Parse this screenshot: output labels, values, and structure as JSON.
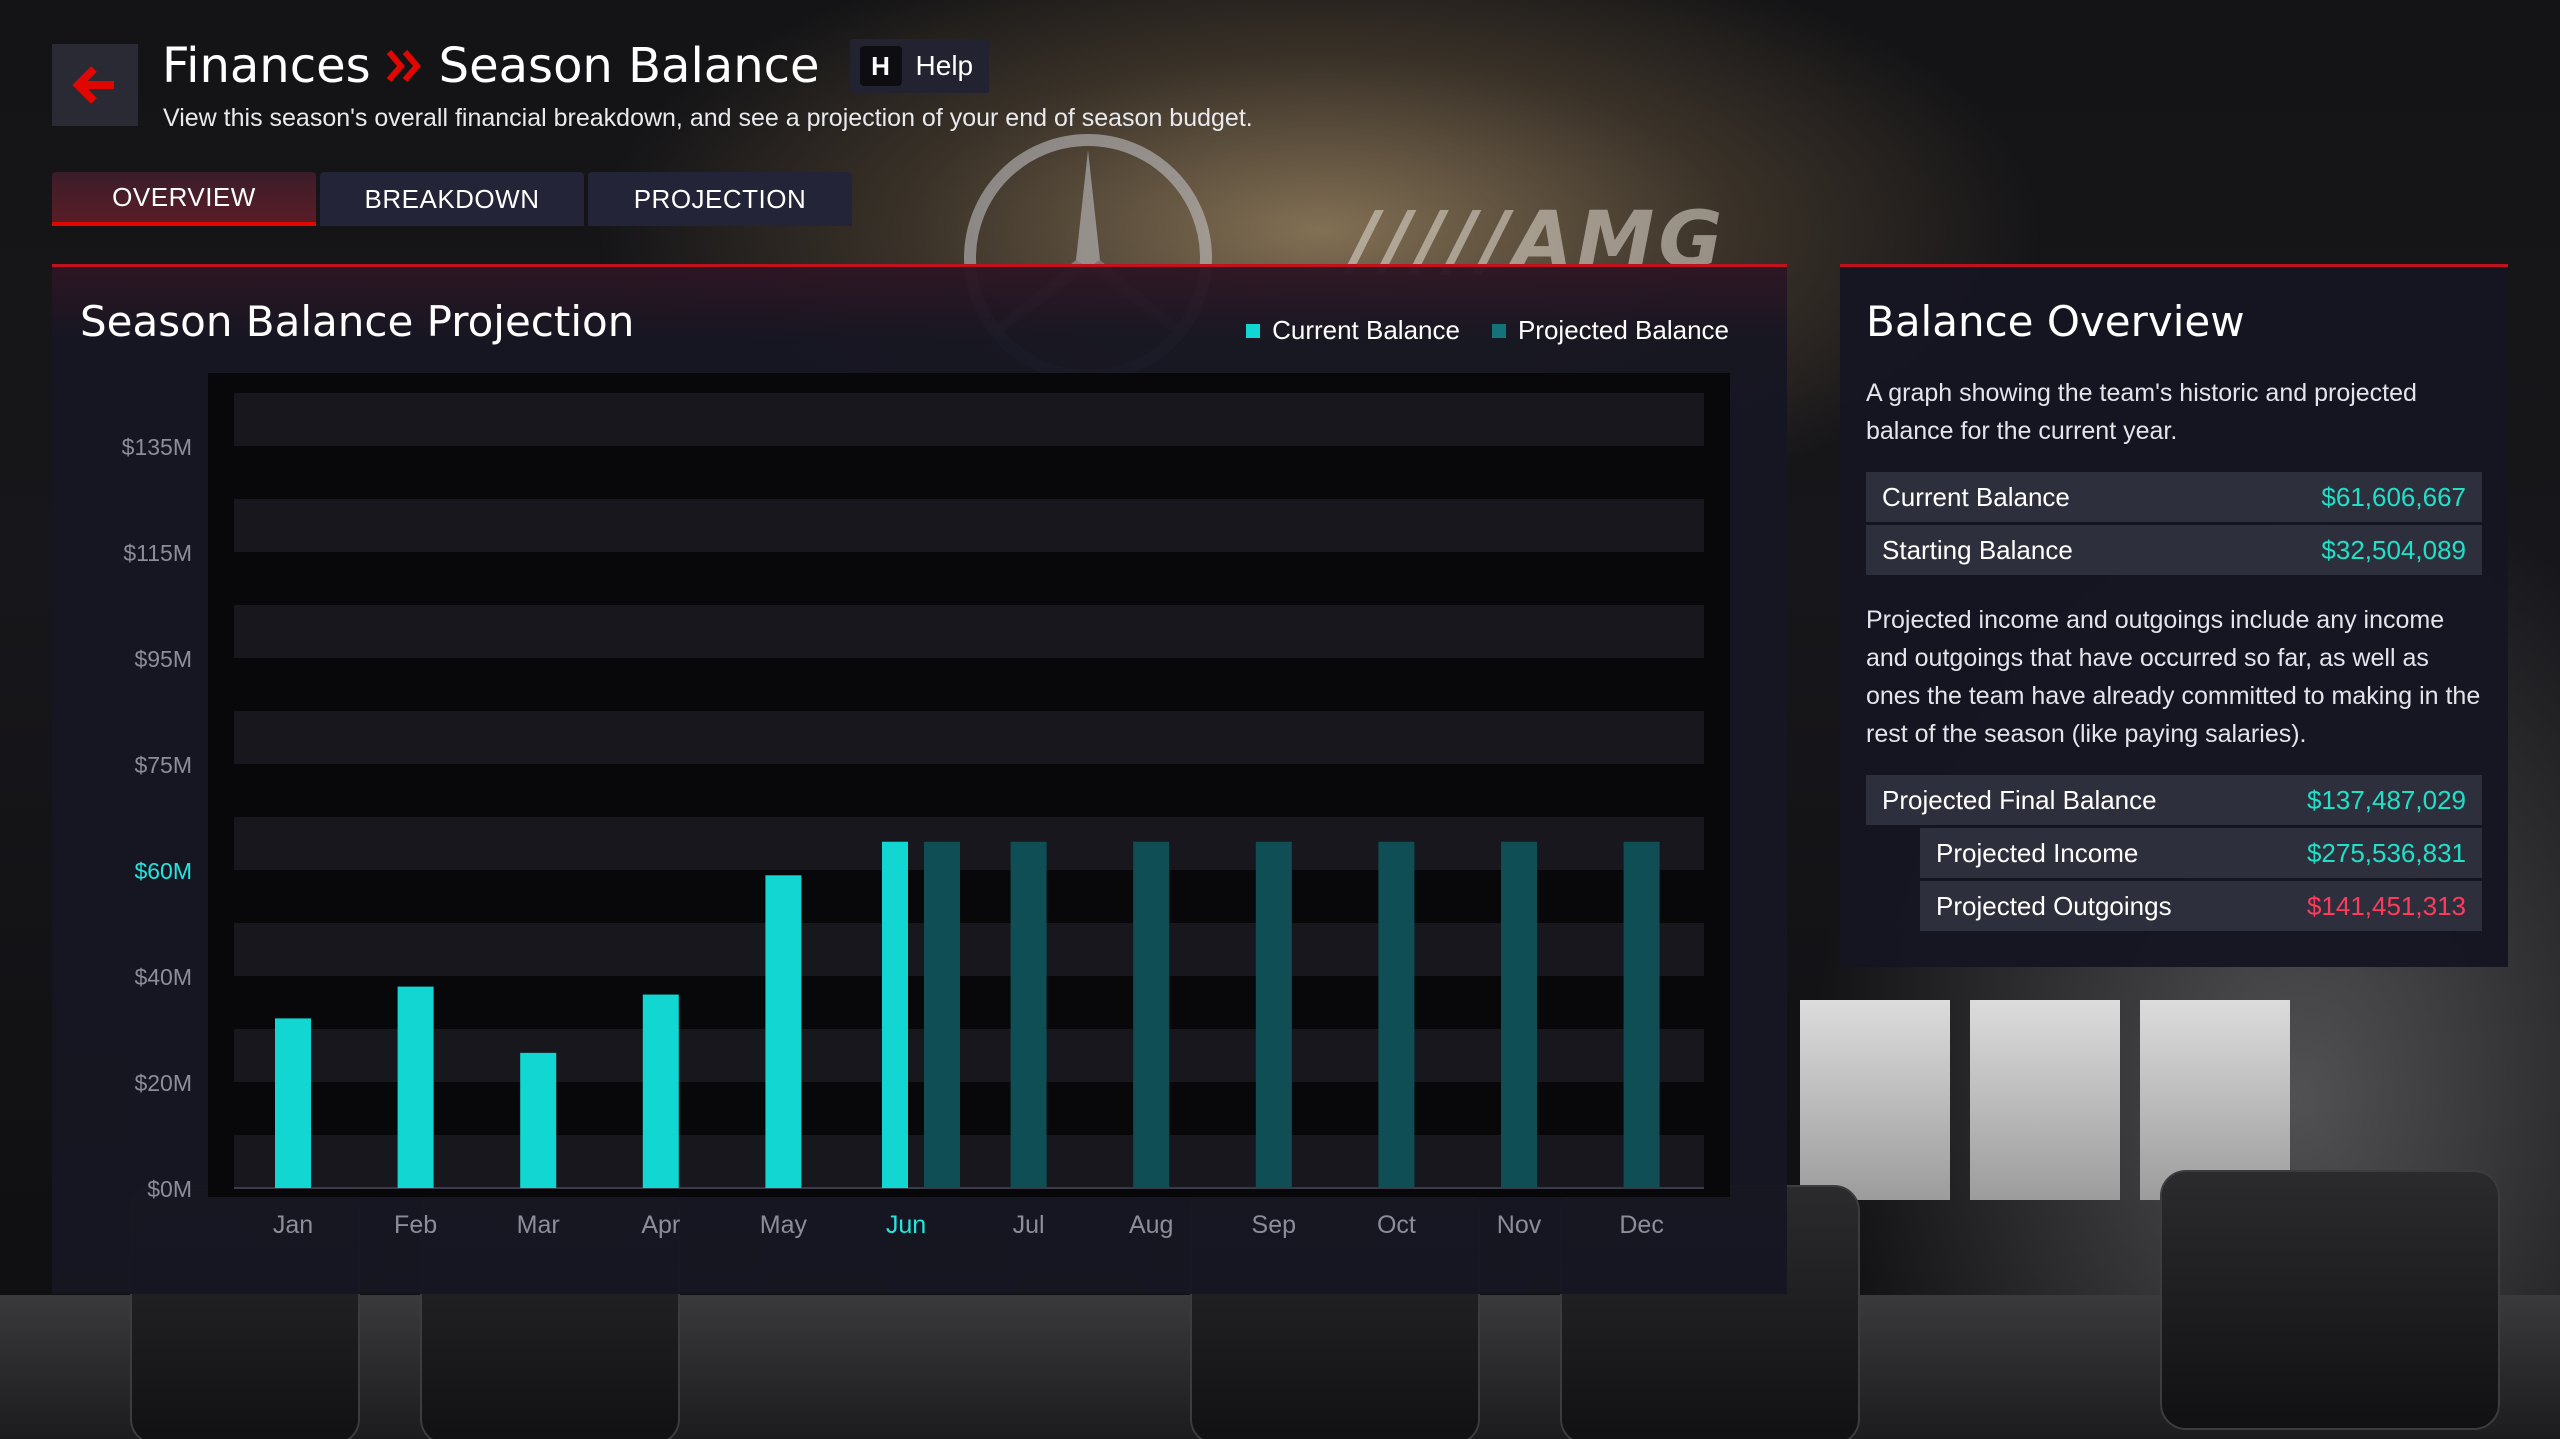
{
  "header": {
    "crumb_1": "Finances",
    "crumb_2": "Season Balance",
    "help_key": "H",
    "help_label": "Help",
    "subtitle": "View this season's overall financial breakdown, and see a projection of your end of season budget."
  },
  "tabs": [
    {
      "label": "OVERVIEW",
      "active": true
    },
    {
      "label": "BREAKDOWN",
      "active": false
    },
    {
      "label": "PROJECTION",
      "active": false
    }
  ],
  "colors": {
    "accent_red": "#e10600",
    "current_balance": "#11d6d2",
    "projected_balance": "#0f4e54",
    "highlight": "#22e6e0"
  },
  "chart_data": {
    "type": "bar",
    "title": "Season Balance Projection",
    "categories": [
      "Jan",
      "Feb",
      "Mar",
      "Apr",
      "May",
      "Jun",
      "Jul",
      "Aug",
      "Sep",
      "Oct",
      "Nov",
      "Dec"
    ],
    "highlight_category": "Jun",
    "y_ticks": [
      "$0M",
      "$20M",
      "$40M",
      "$60M",
      "$75M",
      "$95M",
      "$115M",
      "$135M"
    ],
    "highlight_tick": "$60M",
    "series": [
      {
        "name": "Current Balance",
        "values": [
          32,
          38,
          25.5,
          36.5,
          59,
          64,
          null,
          null,
          null,
          null,
          null,
          null
        ]
      },
      {
        "name": "Projected Balance",
        "values": [
          null,
          null,
          null,
          null,
          null,
          64,
          64,
          64,
          64,
          64,
          64,
          64
        ]
      }
    ],
    "legend_position": "top-right",
    "grid": "striped-horizontal"
  },
  "overview": {
    "title": "Balance Overview",
    "description": "A graph showing the team's historic and projected balance for the current year.",
    "current_balance_label": "Current Balance",
    "current_balance_value": "$61,606,667",
    "starting_balance_label": "Starting Balance",
    "starting_balance_value": "$32,504,089",
    "projection_note": "Projected income and outgoings include any income and outgoings that have occurred so far, as well as ones the team have already committed to making in the rest of the season (like paying salaries).",
    "projected_final_label": "Projected Final Balance",
    "projected_final_value": "$137,487,029",
    "projected_income_label": "Projected Income",
    "projected_income_value": "$275,536,831",
    "projected_outgoings_label": "Projected Outgoings",
    "projected_outgoings_value": "$141,451,313"
  },
  "icons": {
    "back": "arrow-left-icon",
    "separator": "double-chevron-right-icon"
  }
}
